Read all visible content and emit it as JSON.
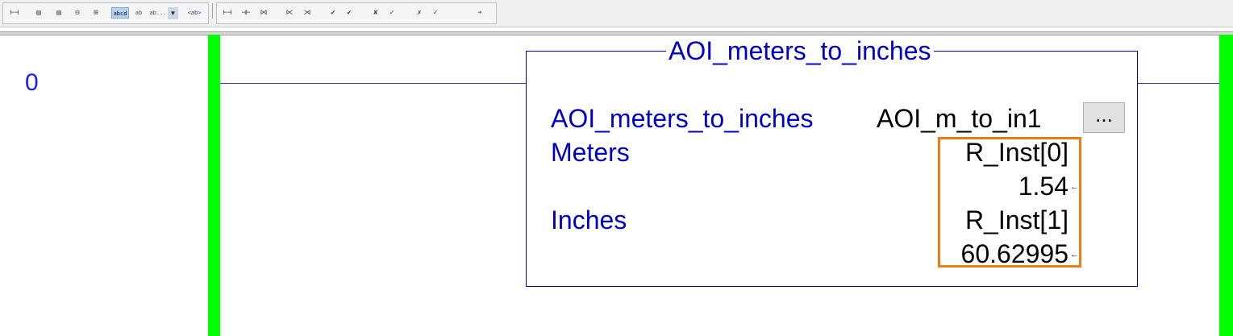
{
  "toolbar": {
    "buttons": [
      {
        "name": "branch-icon",
        "glyph": "⊢⊣"
      },
      {
        "name": "copy-rung-icon",
        "glyph": "▤"
      },
      {
        "name": "paste-rung-icon",
        "glyph": "▤"
      },
      {
        "name": "insert-rung-icon",
        "glyph": "⊟"
      },
      {
        "name": "insert-branch-icon",
        "glyph": "⊞"
      },
      {
        "name": "text-abcd-icon",
        "glyph": "abcd"
      },
      {
        "name": "text-wrap-icon",
        "glyph": "ab cd"
      },
      {
        "name": "text-truncate-icon",
        "glyph": "ab..."
      },
      {
        "name": "dropdown-arrow-icon",
        "glyph": "▼"
      },
      {
        "name": "tag-description-icon",
        "glyph": "<ab>"
      },
      {
        "name": "contact-open-icon",
        "glyph": "⊢⊣"
      },
      {
        "name": "contact-closed-icon",
        "glyph": "⊣⊢"
      },
      {
        "name": "contact-remove-icon",
        "glyph": "⋈"
      },
      {
        "name": "coil-icon",
        "glyph": "⋉"
      },
      {
        "name": "coil-remove-icon",
        "glyph": "⋊"
      },
      {
        "name": "verify-icon",
        "glyph": "✔"
      },
      {
        "name": "verify-all-icon",
        "glyph": "✔"
      },
      {
        "name": "verify-errors-icon",
        "glyph": "✘"
      },
      {
        "name": "check-icon",
        "glyph": "✓"
      },
      {
        "name": "check-error-icon",
        "glyph": "✗"
      },
      {
        "name": "go-to-icon",
        "glyph": "➔"
      }
    ]
  },
  "rung": {
    "number": "0"
  },
  "aoi": {
    "title": "AOI_meters_to_inches",
    "instruction_name": "AOI_meters_to_inches",
    "instance_tag": "AOI_m_to_in1",
    "ellipsis_label": "...",
    "parameters": [
      {
        "name": "Meters",
        "tag": "R_Inst[0]",
        "value": "1.54"
      },
      {
        "name": "Inches",
        "tag": "R_Inst[1]",
        "value": "60.62995"
      }
    ]
  },
  "colors": {
    "rail": "#00ff00",
    "instruction_text": "#0000cc",
    "highlight": "#f07b10"
  }
}
